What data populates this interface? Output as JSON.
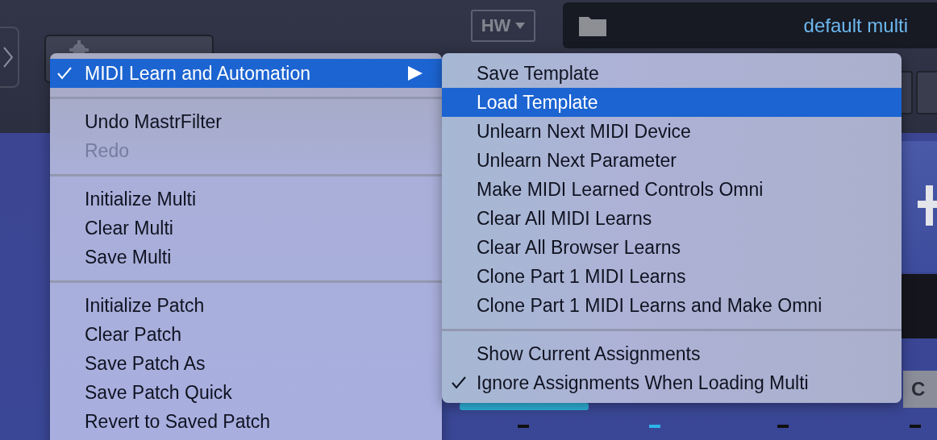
{
  "app": {
    "hw_dropdown": {
      "label": "HW"
    },
    "file_field": {
      "value": "default multi"
    },
    "key_label": "C"
  },
  "menu": {
    "items": [
      {
        "kind": "item",
        "label": "MIDI Learn and Automation",
        "checked": true,
        "selected": true,
        "disabled": false,
        "has_submenu": true
      },
      {
        "kind": "separator"
      },
      {
        "kind": "item",
        "label": "Undo MastrFilter",
        "checked": false,
        "selected": false,
        "disabled": false,
        "has_submenu": false
      },
      {
        "kind": "item",
        "label": "Redo",
        "checked": false,
        "selected": false,
        "disabled": true,
        "has_submenu": false
      },
      {
        "kind": "separator"
      },
      {
        "kind": "item",
        "label": "Initialize Multi",
        "checked": false,
        "selected": false,
        "disabled": false,
        "has_submenu": false
      },
      {
        "kind": "item",
        "label": "Clear Multi",
        "checked": false,
        "selected": false,
        "disabled": false,
        "has_submenu": false
      },
      {
        "kind": "item",
        "label": "Save Multi",
        "checked": false,
        "selected": false,
        "disabled": false,
        "has_submenu": false
      },
      {
        "kind": "separator"
      },
      {
        "kind": "item",
        "label": "Initialize Patch",
        "checked": false,
        "selected": false,
        "disabled": false,
        "has_submenu": false
      },
      {
        "kind": "item",
        "label": "Clear Patch",
        "checked": false,
        "selected": false,
        "disabled": false,
        "has_submenu": false
      },
      {
        "kind": "item",
        "label": "Save Patch As",
        "checked": false,
        "selected": false,
        "disabled": false,
        "has_submenu": false
      },
      {
        "kind": "item",
        "label": "Save Patch Quick",
        "checked": false,
        "selected": false,
        "disabled": false,
        "has_submenu": false
      },
      {
        "kind": "item",
        "label": "Revert to Saved Patch",
        "checked": false,
        "selected": false,
        "disabled": false,
        "has_submenu": false
      }
    ]
  },
  "submenu": {
    "items": [
      {
        "kind": "item",
        "label": "Save Template",
        "checked": false,
        "selected": false,
        "disabled": false
      },
      {
        "kind": "item",
        "label": "Load Template",
        "checked": false,
        "selected": true,
        "disabled": false
      },
      {
        "kind": "item",
        "label": "Unlearn Next MIDI Device",
        "checked": false,
        "selected": false,
        "disabled": false
      },
      {
        "kind": "item",
        "label": "Unlearn Next Parameter",
        "checked": false,
        "selected": false,
        "disabled": false
      },
      {
        "kind": "item",
        "label": "Make MIDI Learned Controls Omni",
        "checked": false,
        "selected": false,
        "disabled": false
      },
      {
        "kind": "item",
        "label": "Clear All MIDI Learns",
        "checked": false,
        "selected": false,
        "disabled": false
      },
      {
        "kind": "item",
        "label": "Clear All Browser Learns",
        "checked": false,
        "selected": false,
        "disabled": false
      },
      {
        "kind": "item",
        "label": "Clone Part 1 MIDI Learns",
        "checked": false,
        "selected": false,
        "disabled": false
      },
      {
        "kind": "item",
        "label": "Clone Part 1 MIDI Learns and Make Omni",
        "checked": false,
        "selected": false,
        "disabled": false
      },
      {
        "kind": "separator"
      },
      {
        "kind": "item",
        "label": "Show Current Assignments",
        "checked": false,
        "selected": false,
        "disabled": false
      },
      {
        "kind": "item",
        "label": "Ignore Assignments When Loading Multi",
        "checked": true,
        "selected": false,
        "disabled": false
      }
    ]
  }
}
